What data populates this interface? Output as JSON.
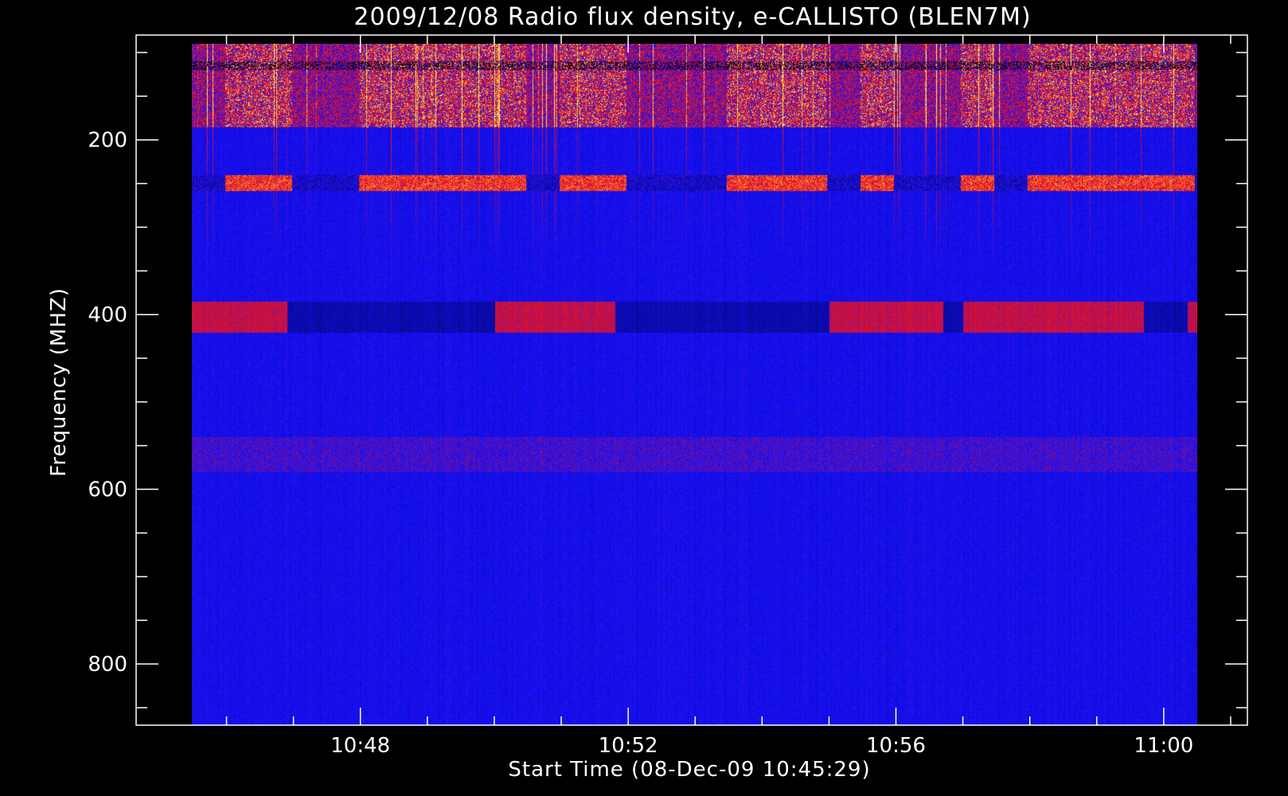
{
  "chart_data": {
    "type": "heatmap",
    "title": "2009/12/08  Radio flux density, e-CALLISTO (BLEN7M)",
    "xlabel": "Start Time (08-Dec-09 10:45:29)",
    "ylabel": "Frequency (MHZ)",
    "x_ticks": [
      {
        "label": "10:48",
        "minutes": 48
      },
      {
        "label": "10:52",
        "minutes": 52
      },
      {
        "label": "10:56",
        "minutes": 56
      },
      {
        "label": "11:00",
        "minutes": 60
      }
    ],
    "x_minor_minutes": [
      46,
      47,
      49,
      50,
      51,
      53,
      54,
      55,
      57,
      58,
      59,
      61,
      62
    ],
    "xlim_minutes": [
      44.65,
      61.25
    ],
    "data_x_range_minutes": [
      45.48,
      60.5
    ],
    "y_ticks": [
      200,
      400,
      600,
      800
    ],
    "y_minor": [
      100,
      150,
      250,
      300,
      350,
      450,
      500,
      550,
      650,
      700,
      750,
      850
    ],
    "ylim": [
      870,
      80
    ],
    "data_y_range": [
      90,
      870
    ],
    "colormap": [
      "#000000",
      "#1010ff",
      "#ff1010",
      "#ffff60"
    ],
    "background_color": "#1414f5",
    "axis_color": "#ffffff",
    "bands": [
      {
        "freq": [
          90,
          185
        ],
        "intensity": "high, flickering"
      },
      {
        "freq": [
          240,
          258
        ],
        "intensity": "high, intermittent"
      },
      {
        "freq": [
          385,
          420
        ],
        "intensity": "medium, switching on/off"
      },
      {
        "freq": [
          540,
          580
        ],
        "intensity": "low"
      }
    ]
  }
}
